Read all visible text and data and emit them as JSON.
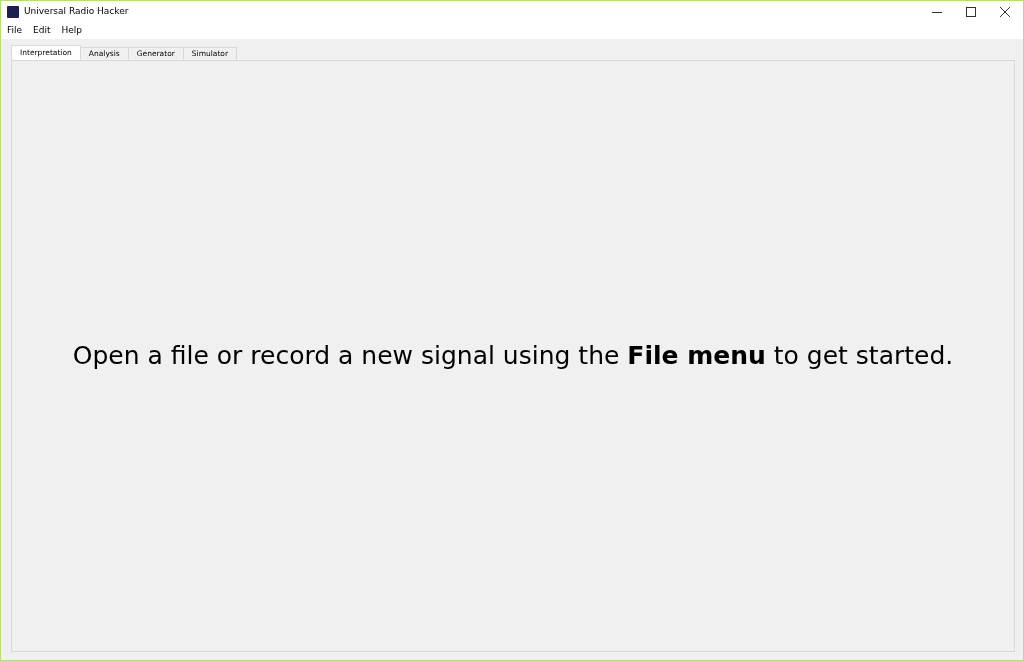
{
  "window": {
    "title": "Universal Radio Hacker"
  },
  "menu": [
    "File",
    "Edit",
    "Help"
  ],
  "tabs": [
    {
      "label": "Interpretation",
      "selected": true
    },
    {
      "label": "Analysis",
      "selected": false
    },
    {
      "label": "Generator",
      "selected": false
    },
    {
      "label": "Simulator",
      "selected": false
    }
  ],
  "message": "Open a file or record a new signal using the **File menu** to get started."
}
